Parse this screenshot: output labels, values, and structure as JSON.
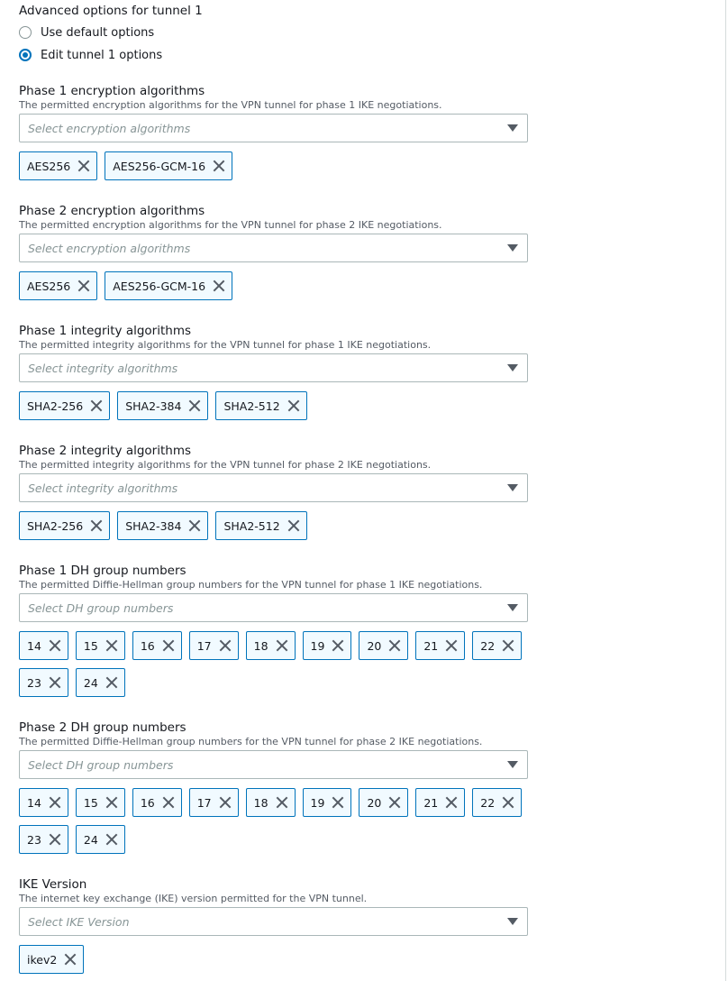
{
  "advanced": {
    "title": "Advanced options for tunnel 1",
    "options": [
      {
        "label": "Use default options",
        "checked": false
      },
      {
        "label": "Edit tunnel 1 options",
        "checked": true
      }
    ]
  },
  "fields": [
    {
      "label": "Phase 1 encryption algorithms",
      "description": "The permitted encryption algorithms for the VPN tunnel for phase 1 IKE negotiations.",
      "placeholder": "Select encryption algorithms",
      "tokens": [
        "AES256",
        "AES256-GCM-16"
      ]
    },
    {
      "label": "Phase 2 encryption algorithms",
      "description": "The permitted encryption algorithms for the VPN tunnel for phase 2 IKE negotiations.",
      "placeholder": "Select encryption algorithms",
      "tokens": [
        "AES256",
        "AES256-GCM-16"
      ]
    },
    {
      "label": "Phase 1 integrity algorithms",
      "description": "The permitted integrity algorithms for the VPN tunnel for phase 1 IKE negotiations.",
      "placeholder": "Select integrity algorithms",
      "tokens": [
        "SHA2-256",
        "SHA2-384",
        "SHA2-512"
      ]
    },
    {
      "label": "Phase 2 integrity algorithms",
      "description": "The permitted integrity algorithms for the VPN tunnel for phase 2 IKE negotiations.",
      "placeholder": "Select integrity algorithms",
      "tokens": [
        "SHA2-256",
        "SHA2-384",
        "SHA2-512"
      ]
    },
    {
      "label": "Phase 1 DH group numbers",
      "description": "The permitted Diffie-Hellman group numbers for the VPN tunnel for phase 1 IKE negotiations.",
      "placeholder": "Select DH group numbers",
      "tokens": [
        "14",
        "15",
        "16",
        "17",
        "18",
        "19",
        "20",
        "21",
        "22",
        "23",
        "24"
      ]
    },
    {
      "label": "Phase 2 DH group numbers",
      "description": "The permitted Diffie-Hellman group numbers for the VPN tunnel for phase 2 IKE negotiations.",
      "placeholder": "Select DH group numbers",
      "tokens": [
        "14",
        "15",
        "16",
        "17",
        "18",
        "19",
        "20",
        "21",
        "22",
        "23",
        "24"
      ]
    },
    {
      "label": "IKE Version",
      "description": "The internet key exchange (IKE) version permitted for the VPN tunnel.",
      "placeholder": "Select IKE Version",
      "tokens": [
        "ikev2"
      ]
    }
  ]
}
